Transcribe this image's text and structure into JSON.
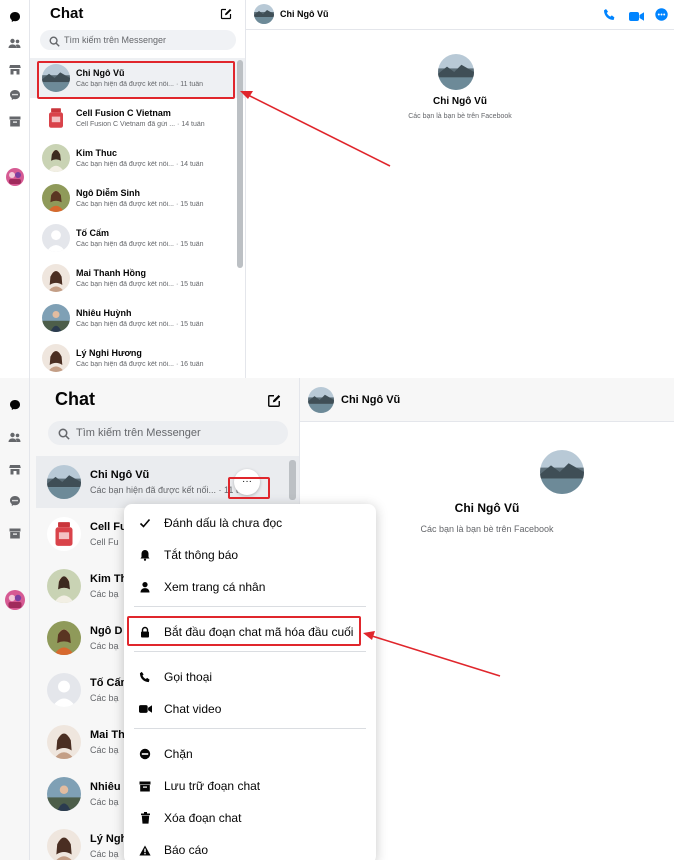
{
  "panel1": {
    "title": "Chat",
    "search_placeholder": "Tìm kiếm trên Messenger",
    "conversations": [
      {
        "name": "Chi Ngô Vũ",
        "preview": "Các bạn hiện đã được kết nối...",
        "time": "· 11 tuần",
        "avatar": "landscape"
      },
      {
        "name": "Cell Fusion C Vietnam",
        "preview": "Cell Fusion C Vietnam đã gửi ...",
        "time": "· 14 tuần",
        "avatar": "product"
      },
      {
        "name": "Kim Thuc",
        "preview": "Các bạn hiện đã được kết nối...",
        "time": "· 14 tuần",
        "avatar": "person-outdoor"
      },
      {
        "name": "Ngô Diễm Sinh",
        "preview": "Các bạn hiện đã được kết nối...",
        "time": "· 15 tuần",
        "avatar": "person-warm"
      },
      {
        "name": "Tố Cấm",
        "preview": "Các bạn hiện đã được kết nối...",
        "time": "· 15 tuần",
        "avatar": "default"
      },
      {
        "name": "Mai Thanh Hồng",
        "preview": "Các bạn hiện đã được kết nối...",
        "time": "· 15 tuần",
        "avatar": "person-portrait"
      },
      {
        "name": "Nhiêu Huỳnh",
        "preview": "Các bạn hiện đã được kết nối...",
        "time": "· 15 tuần",
        "avatar": "person-road"
      },
      {
        "name": "Lý Nghi Hương",
        "preview": "Các bạn hiện đã được kết nối...",
        "time": "· 16 tuần",
        "avatar": "person-portrait"
      }
    ],
    "header_name": "Chi Ngô Vũ",
    "profile_name": "Chi Ngô Vũ",
    "profile_sub": "Các bạn là bạn bè trên Facebook"
  },
  "panel2": {
    "title": "Chat",
    "search_placeholder": "Tìm kiếm trên Messenger",
    "conversations": [
      {
        "name": "Chi Ngô Vũ",
        "preview": "Các bạn hiện đã được kết nối...",
        "time": "· 11 tuần",
        "avatar": "landscape"
      },
      {
        "name": "Cell Fu",
        "preview": "Cell Fu",
        "time": "",
        "avatar": "product"
      },
      {
        "name": "Kim Th",
        "preview": "Các bạ",
        "time": "",
        "avatar": "person-outdoor"
      },
      {
        "name": "Ngô D",
        "preview": "Các bạ",
        "time": "",
        "avatar": "person-warm"
      },
      {
        "name": "Tố Cấm",
        "preview": "Các bạ",
        "time": "",
        "avatar": "default"
      },
      {
        "name": "Mai Th",
        "preview": "Các bạ",
        "time": "",
        "avatar": "person-portrait"
      },
      {
        "name": "Nhiêu",
        "preview": "Các bạ",
        "time": "",
        "avatar": "person-road"
      },
      {
        "name": "Lý Ngh",
        "preview": "Các bạ",
        "time": "",
        "avatar": "person-portrait"
      }
    ],
    "header_name": "Chi Ngô Vũ",
    "profile_name": "Chi Ngô Vũ",
    "profile_sub": "Các bạn là bạn bè trên Facebook",
    "menu": [
      {
        "label": "Đánh dấu là chưa đọc",
        "icon": "check-icon"
      },
      {
        "label": "Tắt thông báo",
        "icon": "bell-icon"
      },
      {
        "label": "Xem trang cá nhân",
        "icon": "person-icon"
      },
      {
        "label": "Bắt đầu đoạn chat mã hóa đầu cuối",
        "icon": "lock-icon"
      },
      {
        "label": "Gọi thoại",
        "icon": "phone-icon"
      },
      {
        "label": "Chat video",
        "icon": "video-icon"
      },
      {
        "label": "Chặn",
        "icon": "block-icon"
      },
      {
        "label": "Lưu trữ đoạn chat",
        "icon": "archive-icon"
      },
      {
        "label": "Xóa đoạn chat",
        "icon": "trash-icon"
      },
      {
        "label": "Báo cáo",
        "icon": "warning-icon"
      }
    ],
    "more_glyph": "···"
  },
  "colors": {
    "accent": "#0084ff",
    "annotation_red": "#e0262c"
  }
}
